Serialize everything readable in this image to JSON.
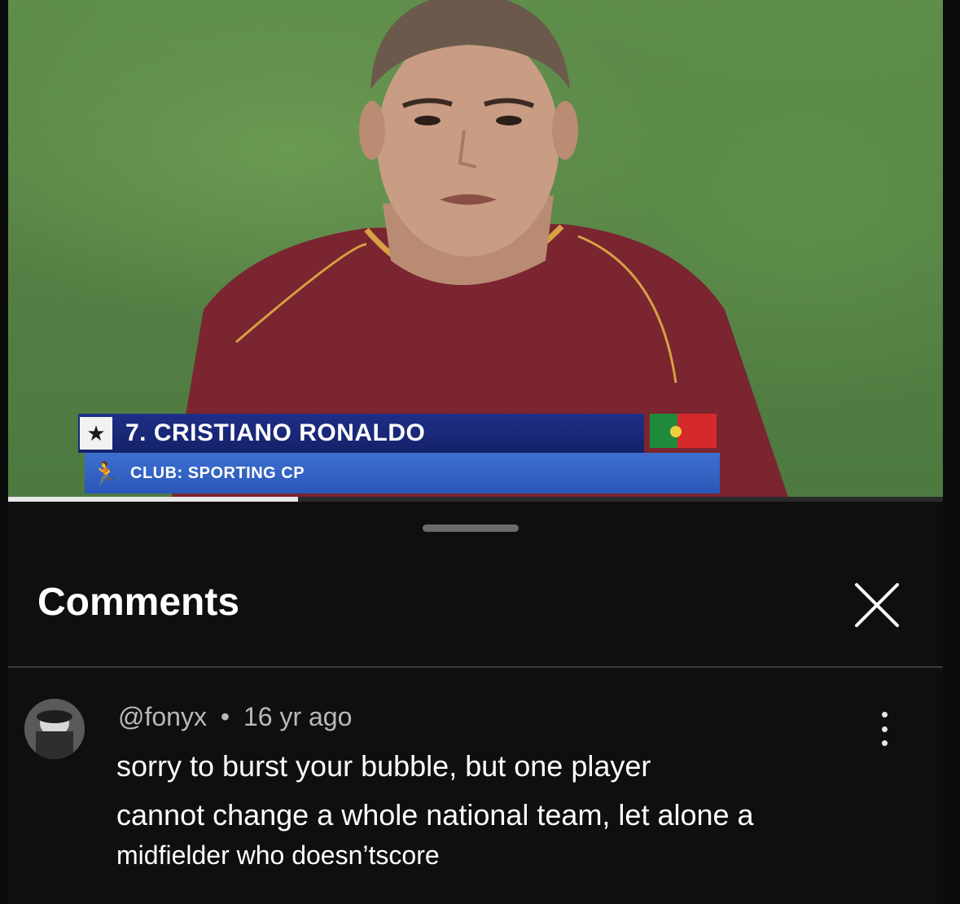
{
  "video": {
    "progress_fraction": 0.31,
    "overlay": {
      "name": "7. CRISTIANO RONALDO",
      "club": "CLUB: SPORTING CP"
    }
  },
  "comments": {
    "title": "Comments",
    "close_icon": "close-icon",
    "items": [
      {
        "author": "@fonyx",
        "separator": "•",
        "age": "16 yr ago",
        "lines": [
          "sorry to burst your bubble, but one player",
          "cannot change a whole national team, let alone a",
          "midfielder who doesn’tscore"
        ]
      }
    ]
  },
  "colors": {
    "overlay_name_bg": "#1d2f86",
    "overlay_club_bg": "#3d6fd0",
    "sheet_bg": "#0f0f10"
  }
}
